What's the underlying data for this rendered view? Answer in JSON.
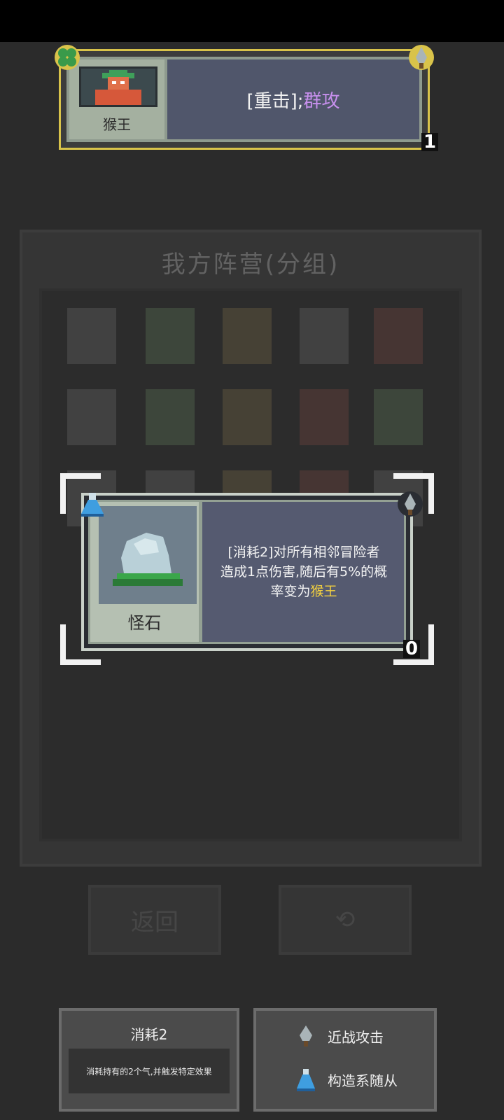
{
  "top_card": {
    "name": "猴王",
    "effect_prefix": "[重击];",
    "effect_highlight": "群攻",
    "count": "1",
    "icons": {
      "top_left": "clover-icon",
      "top_right": "sword-icon"
    },
    "colors": {
      "border": "#d9c34a",
      "highlight": "#c890ee"
    }
  },
  "background": {
    "panel_title": "我方阵营(分组)",
    "back_button": "返回",
    "refresh_icon": "refresh-icon"
  },
  "main_card": {
    "name": "怪石",
    "effect_line1": "[消耗2]对所有相邻冒险者",
    "effect_line2": "造成1点伤害,随后有5%的概",
    "effect_line3_prefix": "率变为",
    "effect_line3_highlight": "猴王",
    "count": "0",
    "icons": {
      "top_left": "flask-icon",
      "top_right": "sword-icon"
    },
    "colors": {
      "highlight": "#f2d040"
    }
  },
  "keyword_box": {
    "title": "消耗2",
    "description": "消耗持有的2个气,并触发特定效果"
  },
  "tags": [
    {
      "icon": "sword-icon",
      "label": "近战攻击"
    },
    {
      "icon": "flask-icon",
      "label": "构造系随从"
    }
  ]
}
